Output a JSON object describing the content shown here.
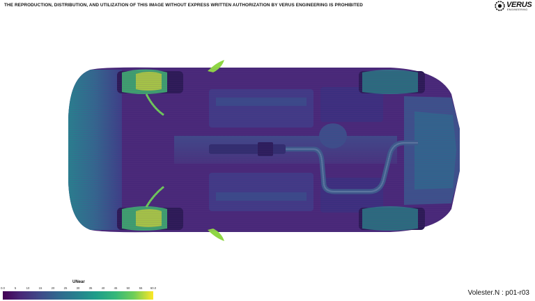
{
  "notice": "THE REPRODUCTION, DISTRIBUTION, AND UTILIZATION OF THIS IMAGE WITHOUT EXPRESS WRITTEN AUTHORIZATION BY VERUS ENGINEERING IS PROHIBITED",
  "logo": {
    "brand": "VERUS",
    "sub": "ENGINEERING"
  },
  "legend": {
    "title": "UNear",
    "ticks": [
      "0.0",
      "5",
      "10",
      "15",
      "20",
      "25",
      "30",
      "35",
      "40",
      "45",
      "50",
      "55",
      "60.0"
    ],
    "colormap": [
      "#440154",
      "#482878",
      "#3e4a89",
      "#31688e",
      "#26828e",
      "#1f9e89",
      "#35b779",
      "#6ece58",
      "#fde725"
    ]
  },
  "caption": "Volester.N : p01-r03"
}
